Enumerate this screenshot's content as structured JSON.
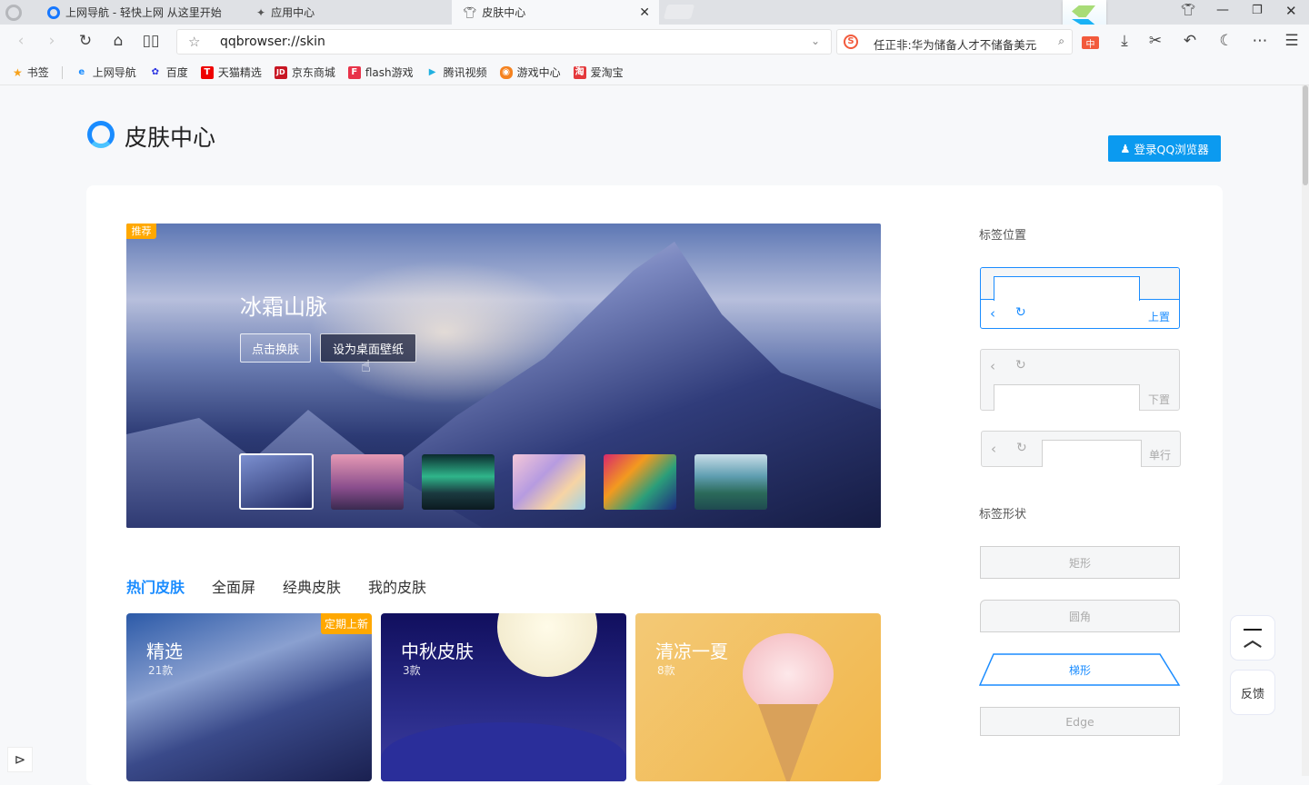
{
  "browser": {
    "tabs": [
      {
        "label": "上网导航 - 轻快上网 从这里开始"
      },
      {
        "label": "应用中心"
      },
      {
        "label": "皮肤中心",
        "active": true
      }
    ],
    "url": "qqbrowser://skin",
    "search_text": "任正非:华为储备人才不储备美元",
    "bookmarks": [
      {
        "label": "书签",
        "icon": "star-icon"
      },
      {
        "label": "上网导航",
        "icon": "ie-icon"
      },
      {
        "label": "百度",
        "icon": "baidu-paw-icon"
      },
      {
        "label": "天猫精选",
        "icon": "tmall-icon"
      },
      {
        "label": "京东商城",
        "icon": "jd-icon"
      },
      {
        "label": "flash游戏",
        "icon": "flash-game-icon"
      },
      {
        "label": "腾讯视频",
        "icon": "tencent-video-icon"
      },
      {
        "label": "游戏中心",
        "icon": "gamepad-icon"
      },
      {
        "label": "爱淘宝",
        "icon": "taobao-icon"
      }
    ]
  },
  "page": {
    "title": "皮肤中心",
    "login_button": "登录QQ浏览器",
    "banner": {
      "badge": "推荐",
      "title": "冰霜山脉",
      "apply_button": "点击换肤",
      "wallpaper_button": "设为桌面壁纸"
    },
    "tabs": [
      {
        "label": "热门皮肤",
        "active": true
      },
      {
        "label": "全面屏"
      },
      {
        "label": "经典皮肤"
      },
      {
        "label": "我的皮肤"
      }
    ],
    "skins": [
      {
        "title": "精选",
        "count": "21款",
        "badge": "定期上新"
      },
      {
        "title": "中秋皮肤",
        "count": "3款"
      },
      {
        "title": "清凉一夏",
        "count": "8款"
      }
    ],
    "tab_position": {
      "label": "标签位置",
      "options": [
        {
          "label": "上置",
          "selected": true
        },
        {
          "label": "下置"
        },
        {
          "label": "单行"
        }
      ]
    },
    "tab_shape": {
      "label": "标签形状",
      "options": [
        {
          "label": "矩形"
        },
        {
          "label": "圆角"
        },
        {
          "label": "梯形",
          "selected": true
        },
        {
          "label": "Edge"
        }
      ]
    },
    "feedback": "反馈"
  },
  "colors": {
    "accent": "#1a8cff",
    "badge": "#ffa800",
    "login": "#0b9af0"
  }
}
